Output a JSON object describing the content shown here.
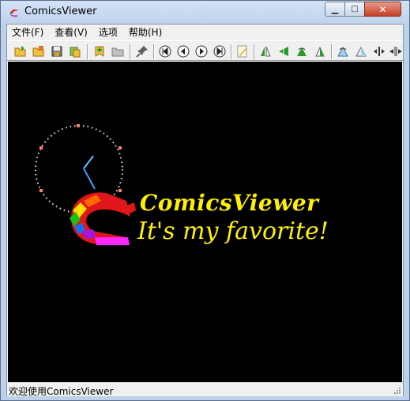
{
  "window": {
    "title": "ComicsViewer",
    "minimize_glyph": "▁",
    "maximize_glyph": "□",
    "close_glyph": "✕"
  },
  "menubar": {
    "items": [
      {
        "label": "文件(F)"
      },
      {
        "label": "查看(V)"
      },
      {
        "label": "选项"
      },
      {
        "label": "帮助(H)"
      }
    ]
  },
  "toolbar": {
    "buttons": [
      {
        "icon": "open-folder-icon"
      },
      {
        "icon": "open-recent-icon"
      },
      {
        "icon": "save-icon"
      },
      {
        "icon": "copy-icon"
      },
      {
        "icon": "bookmark-add-icon"
      },
      {
        "icon": "bookmark-folder-icon"
      },
      {
        "icon": "pin-icon"
      },
      {
        "icon": "first-page-icon"
      },
      {
        "icon": "previous-page-icon"
      },
      {
        "icon": "next-page-icon"
      },
      {
        "icon": "last-page-icon"
      },
      {
        "icon": "edit-icon"
      },
      {
        "icon": "flip-icon"
      },
      {
        "icon": "rotate-left-icon"
      },
      {
        "icon": "rotate-icon"
      },
      {
        "icon": "rotate-right-icon"
      },
      {
        "icon": "mirror-icon"
      },
      {
        "icon": "mirror-right-icon"
      },
      {
        "icon": "fit-width-icon"
      },
      {
        "icon": "fit-split-icon"
      }
    ]
  },
  "viewer": {
    "logo_title": "ComicsViewer",
    "logo_subtitle": "It's my favorite!",
    "background": "#000000",
    "text_color": "#ffef00"
  },
  "statusbar": {
    "text": "欢迎使用ComicsViewer"
  }
}
